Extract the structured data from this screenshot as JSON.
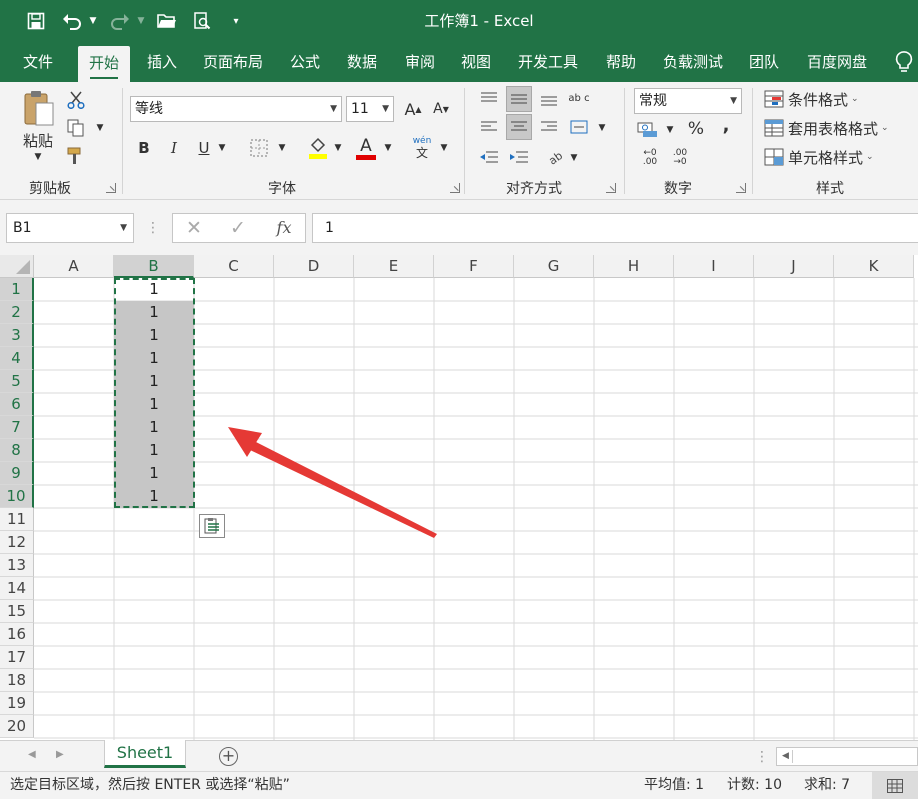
{
  "window": {
    "title": "工作簿1 - Excel"
  },
  "tabs": [
    "文件",
    "开始",
    "插入",
    "页面布局",
    "公式",
    "数据",
    "审阅",
    "视图",
    "开发工具",
    "帮助",
    "负载测试",
    "团队",
    "百度网盘"
  ],
  "ribbon": {
    "clipboard": {
      "paste_label": "粘贴",
      "group_label": "剪贴板"
    },
    "font": {
      "font_name": "等线",
      "font_size": "11",
      "grow_label": "A",
      "shrink_label": "A",
      "bold": "B",
      "italic": "I",
      "underline": "U",
      "font_color_label": "A",
      "phonetic_top": "wén",
      "phonetic_bottom": "文",
      "group_label": "字体"
    },
    "alignment": {
      "group_label": "对齐方式",
      "wrap_label": "ab c"
    },
    "number": {
      "format": "常规",
      "percent": "%",
      "comma": ",",
      "inc_decimal": "←0 .00",
      "dec_decimal": ".00 →0",
      "group_label": "数字"
    },
    "styles": {
      "conditional": "条件格式",
      "table_format": "套用表格格式",
      "cell_styles": "单元格样式",
      "group_label": "样式"
    }
  },
  "formula_bar": {
    "name_box": "B1",
    "fx": "fx",
    "value": "1"
  },
  "columns": [
    "A",
    "B",
    "C",
    "D",
    "E",
    "F",
    "G",
    "H",
    "I",
    "J",
    "K"
  ],
  "rows": [
    "1",
    "2",
    "3",
    "4",
    "5",
    "6",
    "7",
    "8",
    "9",
    "10",
    "11",
    "12",
    "13",
    "14",
    "15",
    "16",
    "17",
    "18",
    "19",
    "20"
  ],
  "cells": {
    "B": [
      "1",
      "1",
      "1",
      "1",
      "1",
      "1",
      "1",
      "1",
      "1",
      "1"
    ]
  },
  "selection": {
    "column": "B",
    "rows_selected": 10
  },
  "sheets": [
    "Sheet1"
  ],
  "status": {
    "message": "选定目标区域，然后按 ENTER 或选择“粘贴”",
    "average": "平均值: 1",
    "count": "计数: 10",
    "sum": "求和: 7"
  },
  "colors": {
    "accent": "#217346",
    "arrow": "#e53935",
    "selection_fill": "#c6c6c6"
  }
}
